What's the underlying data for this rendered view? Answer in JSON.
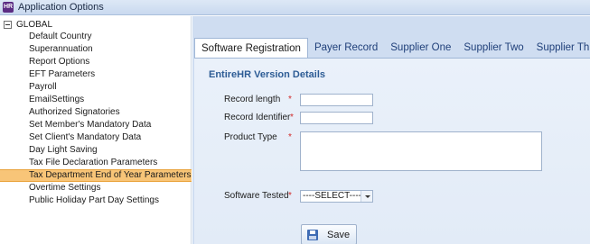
{
  "window": {
    "title": "Application Options",
    "icon": "app-icon"
  },
  "tree": {
    "root_label": "GLOBAL",
    "items": [
      {
        "label": "Default Country"
      },
      {
        "label": "Superannuation"
      },
      {
        "label": "Report Options"
      },
      {
        "label": "EFT Parameters"
      },
      {
        "label": "Payroll"
      },
      {
        "label": "EmailSettings"
      },
      {
        "label": "Authorized Signatories"
      },
      {
        "label": "Set Member's Mandatory Data"
      },
      {
        "label": "Set Client's Mandatory Data"
      },
      {
        "label": "Day Light Saving"
      },
      {
        "label": "Tax File Declaration Parameters"
      },
      {
        "label": "Tax Department End of Year Parameters",
        "selected": true
      },
      {
        "label": "Overtime Settings"
      },
      {
        "label": "Public Holiday Part Day Settings"
      }
    ]
  },
  "tabs": [
    {
      "label": "Software Registration",
      "active": true
    },
    {
      "label": "Payer Record"
    },
    {
      "label": "Supplier One"
    },
    {
      "label": "Supplier Two"
    },
    {
      "label": "Supplier Three"
    }
  ],
  "form": {
    "section_title": "EntireHR Version Details",
    "required_marker": "*",
    "record_length": {
      "label": "Record length",
      "value": ""
    },
    "record_identifier": {
      "label": "Record Identifier",
      "value": ""
    },
    "product_type": {
      "label": "Product Type",
      "value": ""
    },
    "software_tested": {
      "label": "Software Tested",
      "selected": "----SELECT----"
    },
    "save_label": "Save"
  },
  "colors": {
    "selected_item": "#f8c578",
    "panel_background": "#cfddf1",
    "section_title": "#2d5c95",
    "required": "#d22b2b"
  }
}
